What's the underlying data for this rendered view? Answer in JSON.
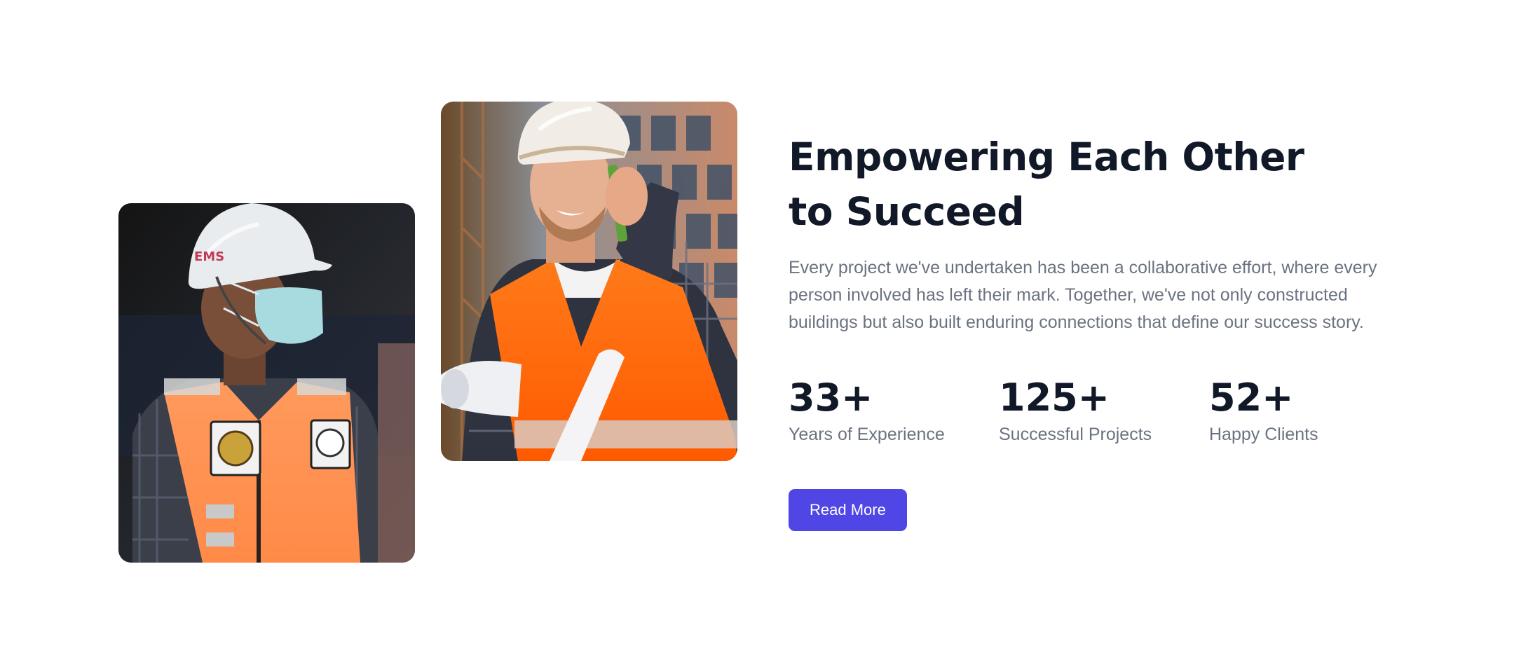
{
  "heading": "Empowering Each Other to Succeed",
  "description": "Every project we've undertaken has been a collaborative effort, where every person involved has left their mark. Together, we've not only constructed buildings but also built enduring connections that define our success story.",
  "stats": [
    {
      "value": "33+",
      "label": "Years of Experience"
    },
    {
      "value": "125+",
      "label": "Successful Projects"
    },
    {
      "value": "52+",
      "label": "Happy Clients"
    }
  ],
  "button": {
    "label": "Read More"
  },
  "colors": {
    "heading": "#111827",
    "body_text": "#6b7280",
    "button_bg": "#4f46e5",
    "button_text": "#ffffff",
    "background": "#ffffff"
  },
  "images": [
    {
      "name": "worker-with-mask-photo",
      "subject": "construction worker in white hard hat, face mask and orange safety vest"
    },
    {
      "name": "worker-on-phone-photo",
      "subject": "smiling construction worker in hard hat and orange vest talking on phone holding blueprints"
    }
  ]
}
